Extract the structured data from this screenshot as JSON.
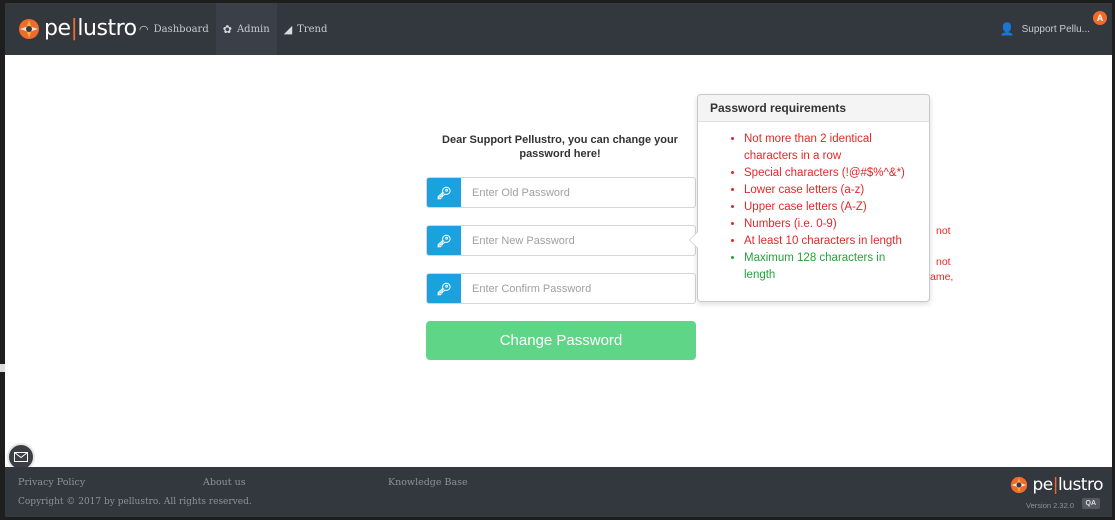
{
  "brand": {
    "name_part1": "pe",
    "name_bar": "|",
    "name_part2": "lustro",
    "accent": "#f06a2a"
  },
  "nav": [
    {
      "label": "Dashboard",
      "icon": "gauge-icon"
    },
    {
      "label": "Admin",
      "icon": "gear-icon"
    },
    {
      "label": "Trend",
      "icon": "bar-chart-icon"
    }
  ],
  "user": {
    "name": "Support Pellu...",
    "badge": "A"
  },
  "form": {
    "intro": "Dear Support Pellustro, you can change your password here!",
    "old_placeholder": "Enter Old Password",
    "new_placeholder": "Enter New Password",
    "confirm_placeholder": "Enter Confirm Password",
    "submit_label": "Change Password"
  },
  "popover": {
    "title": "Password requirements",
    "requirements": [
      {
        "text": "Not more than 2 identical characters in a row",
        "status": "unmet"
      },
      {
        "text": "Special characters (!@#$%^&*)",
        "status": "unmet"
      },
      {
        "text": "Lower case letters (a-z)",
        "status": "unmet"
      },
      {
        "text": "Upper case letters (A-Z)",
        "status": "unmet"
      },
      {
        "text": "Numbers (i.e. 0-9)",
        "status": "unmet"
      },
      {
        "text": "At least 10 characters in length",
        "status": "unmet"
      },
      {
        "text": "Maximum 128 characters in length",
        "status": "met"
      }
    ]
  },
  "overflow_text": {
    "t1": "not",
    "t2": "not",
    "t3": "ame,"
  },
  "footer": {
    "privacy": "Privacy Policy",
    "about": "About us",
    "kb": "Knowledge Base",
    "copyright": "Copyright © 2017 by pellustro. All rights reserved.",
    "version": "Version 2.32.0",
    "env": "QA"
  },
  "colors": {
    "navbar": "#33373e",
    "key_button": "#1ca1df",
    "submit": "#5fd687",
    "error": "#e52727",
    "ok": "#22a43a"
  }
}
